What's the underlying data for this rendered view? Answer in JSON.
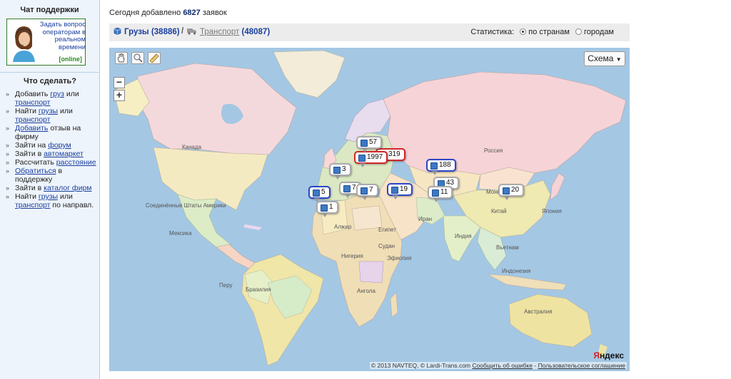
{
  "sidebar": {
    "support_title": "Чат поддержки",
    "support_text": "Задать вопрос операторам в реальном времени",
    "support_status": "[online]",
    "todo_title": "Что сделать?",
    "todo": [
      {
        "pre": "Добавить ",
        "link1": "груз",
        "mid": " или ",
        "link2": "транспорт",
        "post": ""
      },
      {
        "pre": "Найти ",
        "link1": "грузы",
        "mid": " или ",
        "link2": "транспорт",
        "post": ""
      },
      {
        "pre": "",
        "link1": "Добавить",
        "mid": " отзыв на фирму",
        "link2": "",
        "post": ""
      },
      {
        "pre": "Зайти на ",
        "link1": "форум",
        "mid": "",
        "link2": "",
        "post": ""
      },
      {
        "pre": "Зайти в ",
        "link1": "автомаркет",
        "mid": "",
        "link2": "",
        "post": ""
      },
      {
        "pre": "Рассчитать ",
        "link1": "расстояние",
        "mid": "",
        "link2": "",
        "post": ""
      },
      {
        "pre": "",
        "link1": "Обратиться",
        "mid": " в поддержку",
        "link2": "",
        "post": ""
      },
      {
        "pre": "Зайти в ",
        "link1": "каталог фирм",
        "mid": "",
        "link2": "",
        "post": ""
      },
      {
        "pre": "Найти ",
        "link1": "грузы",
        "mid": " или ",
        "link2": "транспорт",
        "post": " по направл."
      }
    ]
  },
  "header": {
    "today_prefix": "Сегодня добавлено",
    "today_count": "6827",
    "today_suffix": "заявок"
  },
  "tabs": {
    "cargo_label": "Грузы",
    "cargo_count": "(38886)",
    "separator": "/",
    "transport_label": "Транспорт",
    "transport_count": "(48087)"
  },
  "stats": {
    "label": "Статистика:",
    "options": [
      "по странам",
      "городам"
    ],
    "selected": "по странам"
  },
  "map": {
    "layer_button": "Схема",
    "zoom_in": "+",
    "zoom_out": "−",
    "labels": {
      "canada": "Канада",
      "usa": "Соединённые Штаты Америки",
      "mexico": "Мексика",
      "russia": "Россия",
      "mongolia": "Монголия",
      "china": "Китай",
      "japan": "Япония",
      "iran": "Иран",
      "india": "Индия",
      "vietnam": "Вьетнам",
      "indonesia": "Индонезия",
      "australia": "Австралия",
      "algeria": "Алжир",
      "egypt": "Египет",
      "nigeria": "Нигерия",
      "sudan": "Судан",
      "ethiopia": "Эфиопия",
      "angola": "Ангола",
      "peru": "Перу",
      "brazil": "Бразилия"
    },
    "markers": [
      {
        "value": "57",
        "style": "gray"
      },
      {
        "value": "1997",
        "style": "red"
      },
      {
        "value": "319",
        "style": "red"
      },
      {
        "value": "3",
        "style": "gray"
      },
      {
        "value": "188",
        "style": "blue"
      },
      {
        "value": "7",
        "style": "blue"
      },
      {
        "value": "7",
        "style": "gray"
      },
      {
        "value": "5",
        "style": "blue"
      },
      {
        "value": "19",
        "style": "blue"
      },
      {
        "value": "43",
        "style": "gray"
      },
      {
        "value": "11",
        "style": "gray"
      },
      {
        "value": "1",
        "style": "gray"
      },
      {
        "value": "20",
        "style": "gray"
      }
    ],
    "copyright": "© 2013 NAVTEQ, © Lardi-Trans.com",
    "report_error": "Сообщить об ошибке",
    "separator": "-",
    "user_agreement": "Пользовательское соглашение",
    "brand_y": "Я",
    "brand_rest": "ндекс"
  }
}
